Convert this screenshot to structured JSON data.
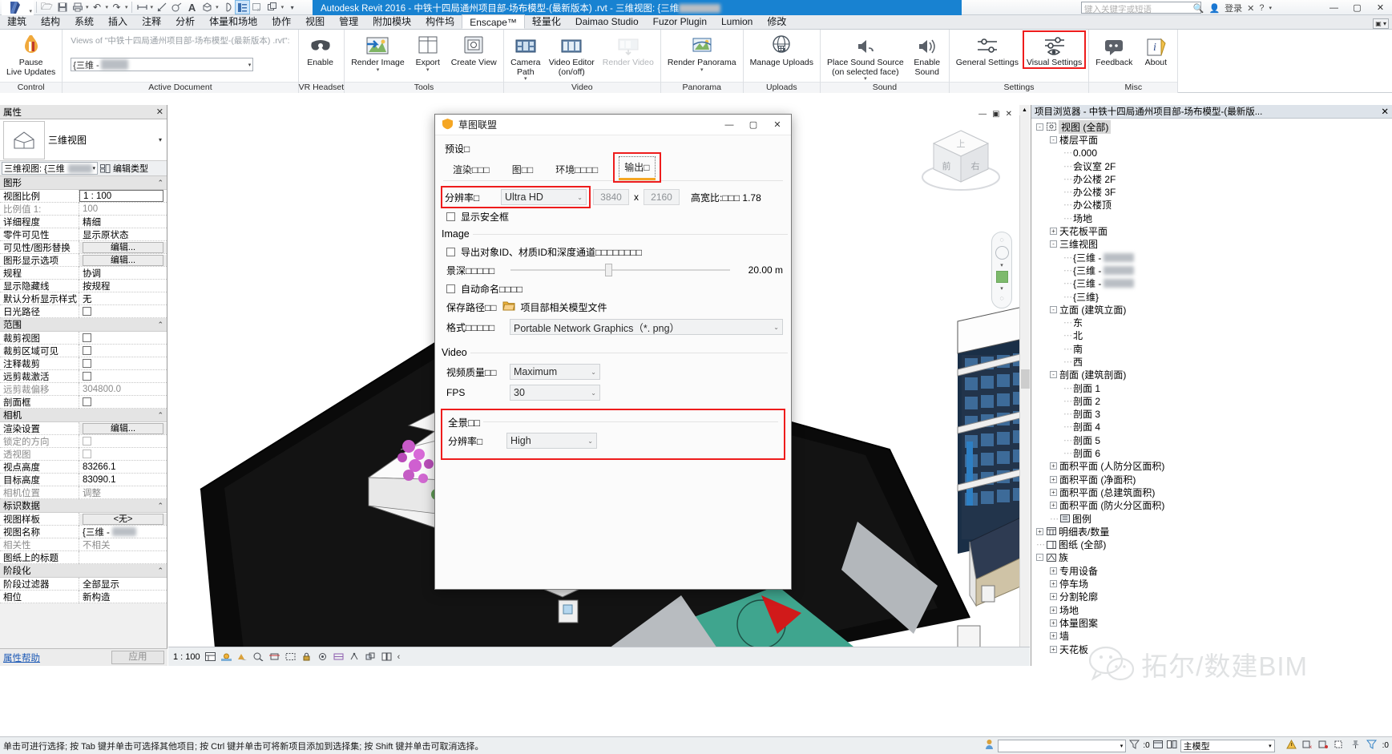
{
  "window": {
    "title": "Autodesk Revit 2016 -  中铁十四局通州项目部-场布模型-(最新版本) .rvt - 三维视图: {三维",
    "search_placeholder": "键入关键字或短语",
    "signin": "登录",
    "minimize": "—",
    "maximize": "▢",
    "close": "✕"
  },
  "quick_access": {
    "items": [
      "open-icon",
      "save-icon",
      "print-icon",
      "undo-icon",
      "redo-icon",
      "measure-icon",
      "dimension-icon",
      "tag-icon",
      "text-icon",
      "3d-view-icon",
      "section-icon",
      "properties-icon",
      "close-hidden-icon",
      "switch-window-icon",
      "customize-icon"
    ]
  },
  "ribbon_tabs": [
    {
      "label": "建筑",
      "active": false
    },
    {
      "label": "结构",
      "active": false
    },
    {
      "label": "系统",
      "active": false
    },
    {
      "label": "插入",
      "active": false
    },
    {
      "label": "注释",
      "active": false
    },
    {
      "label": "分析",
      "active": false
    },
    {
      "label": "体量和场地",
      "active": false
    },
    {
      "label": "协作",
      "active": false
    },
    {
      "label": "视图",
      "active": false
    },
    {
      "label": "管理",
      "active": false
    },
    {
      "label": "附加模块",
      "active": false
    },
    {
      "label": "构件坞",
      "active": false
    },
    {
      "label": "Enscape™",
      "active": true
    },
    {
      "label": "轻量化",
      "active": false
    },
    {
      "label": "Daimao Studio",
      "active": false
    },
    {
      "label": "Fuzor Plugin",
      "active": false
    },
    {
      "label": "Lumion",
      "active": false
    },
    {
      "label": "修改",
      "active": false
    }
  ],
  "ribbon_panels": [
    {
      "title": "Control",
      "buttons": [
        {
          "label": "Pause\nLive Updates",
          "icon": "pause-flame-icon",
          "disabled": false,
          "caret": false
        }
      ]
    },
    {
      "title": "Active Document",
      "caption": "Views of \"中铁十四局通州项目部-场布模型-(最新版本) .rvt\":",
      "combo_value": "{三维 - "
    },
    {
      "title": "VR Headset",
      "buttons": [
        {
          "label": "Enable",
          "icon": "vr-headset-icon",
          "disabled": false,
          "caret": false
        }
      ]
    },
    {
      "title": "Tools",
      "buttons": [
        {
          "label": "Render Image",
          "icon": "render-image-icon",
          "disabled": false,
          "caret": true
        },
        {
          "label": "Export",
          "icon": "export-icon",
          "disabled": false,
          "caret": true
        },
        {
          "label": "Create View",
          "icon": "create-view-icon",
          "disabled": false,
          "caret": false
        }
      ]
    },
    {
      "title": "Video",
      "buttons": [
        {
          "label": "Camera\nPath",
          "icon": "camera-path-icon",
          "disabled": false,
          "caret": true
        },
        {
          "label": "Video Editor\n(on/off)",
          "icon": "video-editor-icon",
          "disabled": false,
          "caret": false
        },
        {
          "label": "Render Video",
          "icon": "render-video-icon",
          "disabled": true,
          "caret": false
        }
      ]
    },
    {
      "title": "Panorama",
      "buttons": [
        {
          "label": "Render Panorama",
          "icon": "render-panorama-icon",
          "disabled": false,
          "caret": true
        }
      ]
    },
    {
      "title": "Uploads",
      "buttons": [
        {
          "label": "Manage Uploads",
          "icon": "manage-uploads-icon",
          "disabled": false,
          "caret": false
        }
      ]
    },
    {
      "title": "Sound",
      "buttons": [
        {
          "label": "Place Sound Source\n(on selected face)",
          "icon": "place-sound-source-icon",
          "disabled": false,
          "caret": true
        },
        {
          "label": "Enable\nSound",
          "icon": "enable-sound-icon",
          "disabled": false,
          "caret": false
        }
      ]
    },
    {
      "title": "Settings",
      "buttons": [
        {
          "label": "General Settings",
          "icon": "general-settings-icon",
          "disabled": false,
          "caret": false
        },
        {
          "label": "Visual Settings",
          "icon": "visual-settings-icon",
          "disabled": false,
          "caret": false,
          "highlight": true
        }
      ]
    },
    {
      "title": "Misc",
      "buttons": [
        {
          "label": "Feedback",
          "icon": "feedback-icon",
          "disabled": false,
          "caret": false
        },
        {
          "label": "About",
          "icon": "about-icon",
          "disabled": false,
          "caret": false
        }
      ]
    }
  ],
  "properties": {
    "panel_title": "属性",
    "close": "✕",
    "type_name": "三维视图",
    "type_selector": "三维视图: {三维",
    "edit_type": "编辑类型",
    "footer_link": "属性帮助",
    "footer_apply": "应用",
    "groups": [
      {
        "name": "图形",
        "rows": [
          {
            "k": "视图比例",
            "v": "1 : 100",
            "kind": "text",
            "boxed": true
          },
          {
            "k": "比例值 1:",
            "v": "100",
            "kind": "text",
            "readonly": true
          },
          {
            "k": "详细程度",
            "v": "精细",
            "kind": "text"
          },
          {
            "k": "零件可见性",
            "v": "显示原状态",
            "kind": "text"
          },
          {
            "k": "可见性/图形替换",
            "v": "编辑...",
            "kind": "button"
          },
          {
            "k": "图形显示选项",
            "v": "编辑...",
            "kind": "button"
          },
          {
            "k": "规程",
            "v": "协调",
            "kind": "text"
          },
          {
            "k": "显示隐藏线",
            "v": "按规程",
            "kind": "text"
          },
          {
            "k": "默认分析显示样式",
            "v": "无",
            "kind": "text"
          },
          {
            "k": "日光路径",
            "v": "",
            "kind": "check"
          }
        ]
      },
      {
        "name": "范围",
        "rows": [
          {
            "k": "裁剪视图",
            "v": "",
            "kind": "check"
          },
          {
            "k": "裁剪区域可见",
            "v": "",
            "kind": "check"
          },
          {
            "k": "注释裁剪",
            "v": "",
            "kind": "check"
          },
          {
            "k": "远剪裁激活",
            "v": "",
            "kind": "check"
          },
          {
            "k": "远剪裁偏移",
            "v": "304800.0",
            "kind": "text",
            "readonly": true
          },
          {
            "k": "剖面框",
            "v": "",
            "kind": "check"
          }
        ]
      },
      {
        "name": "相机",
        "rows": [
          {
            "k": "渲染设置",
            "v": "编辑...",
            "kind": "button"
          },
          {
            "k": "锁定的方向",
            "v": "",
            "kind": "check",
            "readonly": true
          },
          {
            "k": "透视图",
            "v": "",
            "kind": "check",
            "readonly": true
          },
          {
            "k": "视点高度",
            "v": "83266.1",
            "kind": "text"
          },
          {
            "k": "目标高度",
            "v": "83090.1",
            "kind": "text"
          },
          {
            "k": "相机位置",
            "v": "调整",
            "kind": "text",
            "readonly": true
          }
        ]
      },
      {
        "name": "标识数据",
        "rows": [
          {
            "k": "视图样板",
            "v": "<无>",
            "kind": "button"
          },
          {
            "k": "视图名称",
            "v": "{三维 -",
            "kind": "text"
          },
          {
            "k": "相关性",
            "v": "不相关",
            "kind": "text",
            "readonly": true
          },
          {
            "k": "图纸上的标题",
            "v": "",
            "kind": "text"
          }
        ]
      },
      {
        "name": "阶段化",
        "rows": [
          {
            "k": "阶段过滤器",
            "v": "全部显示",
            "kind": "text"
          },
          {
            "k": "相位",
            "v": "新构造",
            "kind": "text"
          }
        ]
      }
    ]
  },
  "dialog": {
    "title": "草图联盟",
    "icon": "enscape-shield-icon",
    "minimize": "—",
    "maximize": "▢",
    "close": "✕",
    "preset_label": "预设□",
    "tabs": [
      {
        "label": "渲染□□□",
        "selected": false
      },
      {
        "label": "图□□",
        "selected": false
      },
      {
        "label": "环境□□□□",
        "selected": false
      },
      {
        "label": "输出□",
        "selected": true
      }
    ],
    "resolution_label": "分辨率□",
    "resolution_value": "Ultra HD",
    "width": "3840",
    "x": "x",
    "height": "2160",
    "aspect_label": "高宽比:□□□ 1.78",
    "safe_frame_label": "显示安全框",
    "image_legend": "Image",
    "export_ids_label": "导出对象ID、材质ID和深度通道□□□□□□□□",
    "depth_label": "景深□□□□□",
    "depth_value": "20.00 m",
    "auto_name_label": "自动命名□□□□",
    "save_path_label": "保存路径□□",
    "save_path_value": "项目部相关模型文件",
    "format_label": "格式□□□□□",
    "format_value": "Portable Network Graphics（*. png）",
    "video_legend": "Video",
    "video_quality_label": "视频质量□□",
    "video_quality_value": "Maximum",
    "fps_label": "FPS",
    "fps_value": "30",
    "panorama_legend": "全景□□",
    "panorama_res_label": "分辨率□",
    "panorama_res_value": "High"
  },
  "browser": {
    "title": "项目浏览器 - 中铁十四局通州项目部-场布模型-(最新版...",
    "close": "✕",
    "nodes": [
      {
        "label": "视图 (全部)",
        "indent": 0,
        "pm": "-",
        "icon": "view-icon",
        "selected": true
      },
      {
        "label": "楼层平面",
        "indent": 1,
        "pm": "-",
        "icon": ""
      },
      {
        "label": "0.000",
        "indent": 2,
        "pm": "",
        "icon": ""
      },
      {
        "label": "会议室 2F",
        "indent": 2,
        "pm": "",
        "icon": ""
      },
      {
        "label": "办公楼 2F",
        "indent": 2,
        "pm": "",
        "icon": ""
      },
      {
        "label": "办公楼 3F",
        "indent": 2,
        "pm": "",
        "icon": ""
      },
      {
        "label": "办公楼顶",
        "indent": 2,
        "pm": "",
        "icon": ""
      },
      {
        "label": "场地",
        "indent": 2,
        "pm": "",
        "icon": ""
      },
      {
        "label": "天花板平面",
        "indent": 1,
        "pm": "+",
        "icon": ""
      },
      {
        "label": "三维视图",
        "indent": 1,
        "pm": "-",
        "icon": ""
      },
      {
        "label": "{三维 -",
        "indent": 2,
        "pm": "",
        "icon": "",
        "blur": true
      },
      {
        "label": "{三维 -",
        "indent": 2,
        "pm": "",
        "icon": "",
        "blur": true
      },
      {
        "label": "{三维 -",
        "indent": 2,
        "pm": "",
        "icon": "",
        "blur": true
      },
      {
        "label": "{三维}",
        "indent": 2,
        "pm": "",
        "icon": ""
      },
      {
        "label": "立面 (建筑立面)",
        "indent": 1,
        "pm": "-",
        "icon": ""
      },
      {
        "label": "东",
        "indent": 2,
        "pm": "",
        "icon": ""
      },
      {
        "label": "北",
        "indent": 2,
        "pm": "",
        "icon": ""
      },
      {
        "label": "南",
        "indent": 2,
        "pm": "",
        "icon": ""
      },
      {
        "label": "西",
        "indent": 2,
        "pm": "",
        "icon": ""
      },
      {
        "label": "剖面 (建筑剖面)",
        "indent": 1,
        "pm": "-",
        "icon": ""
      },
      {
        "label": "剖面 1",
        "indent": 2,
        "pm": "",
        "icon": ""
      },
      {
        "label": "剖面 2",
        "indent": 2,
        "pm": "",
        "icon": ""
      },
      {
        "label": "剖面 3",
        "indent": 2,
        "pm": "",
        "icon": ""
      },
      {
        "label": "剖面 4",
        "indent": 2,
        "pm": "",
        "icon": ""
      },
      {
        "label": "剖面 5",
        "indent": 2,
        "pm": "",
        "icon": ""
      },
      {
        "label": "剖面 6",
        "indent": 2,
        "pm": "",
        "icon": ""
      },
      {
        "label": "面积平面 (人防分区面积)",
        "indent": 1,
        "pm": "+",
        "icon": ""
      },
      {
        "label": "面积平面 (净面积)",
        "indent": 1,
        "pm": "+",
        "icon": ""
      },
      {
        "label": "面积平面 (总建筑面积)",
        "indent": 1,
        "pm": "+",
        "icon": ""
      },
      {
        "label": "面积平面 (防火分区面积)",
        "indent": 1,
        "pm": "+",
        "icon": ""
      },
      {
        "label": "图例",
        "indent": 1,
        "pm": "",
        "icon": "legend-icon"
      },
      {
        "label": "明细表/数量",
        "indent": 0,
        "pm": "+",
        "icon": "schedule-icon"
      },
      {
        "label": "图纸 (全部)",
        "indent": 0,
        "pm": "",
        "icon": "sheet-icon"
      },
      {
        "label": "族",
        "indent": 0,
        "pm": "-",
        "icon": "family-icon"
      },
      {
        "label": "专用设备",
        "indent": 1,
        "pm": "+",
        "icon": ""
      },
      {
        "label": "停车场",
        "indent": 1,
        "pm": "+",
        "icon": ""
      },
      {
        "label": "分割轮廓",
        "indent": 1,
        "pm": "+",
        "icon": ""
      },
      {
        "label": "场地",
        "indent": 1,
        "pm": "+",
        "icon": ""
      },
      {
        "label": "体量图案",
        "indent": 1,
        "pm": "+",
        "icon": ""
      },
      {
        "label": "墙",
        "indent": 1,
        "pm": "+",
        "icon": ""
      },
      {
        "label": "天花板",
        "indent": 1,
        "pm": "+",
        "icon": ""
      }
    ]
  },
  "view_control": {
    "scale": "1 : 100",
    "icons": [
      "visual-style-icon",
      "sun-path-icon",
      "shadows-icon",
      "render-dialog-icon",
      "crop-view-icon",
      "show-crop-icon",
      "lock-3d-icon",
      "temp-hide-icon",
      "reveal-hidden-icon",
      "analytical-model-icon",
      "highlight-displace-icon",
      "worksharing-icon"
    ],
    "overflow": "‹"
  },
  "statusbar": {
    "hint": "单击可进行选择; 按 Tab 键并单击可选择其他项目; 按 Ctrl 键并单击可将新项目添加到选择集; 按 Shift 键并单击可取消选择。",
    "filter_value": "",
    "model_label": "主模型",
    "count": ":0",
    "zero": ":0"
  },
  "watermark": {
    "text": "拓尔/数建BIM",
    "icon": "wechat-icon"
  },
  "colors": {
    "accent": "#1882d1",
    "highlight_red": "#ee1c1c",
    "tab_underline": "#f5a623",
    "panel_bg": "#f0f0f0"
  }
}
